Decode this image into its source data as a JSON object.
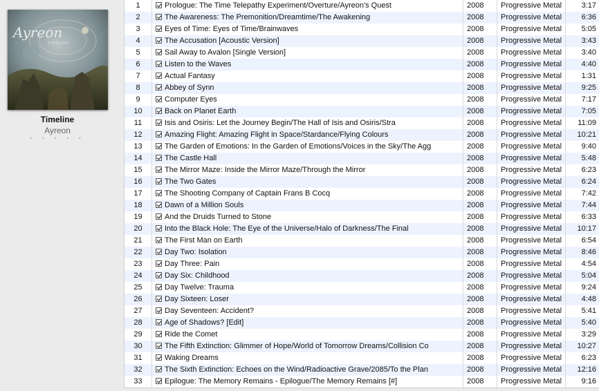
{
  "album": {
    "title": "Timeline",
    "artist": "Ayreon",
    "art_text": "Ayreon",
    "art_subtext": "TIMELINE",
    "rating": "• • • • •"
  },
  "tracks": [
    {
      "num": "1",
      "name": "Prologue: The Time Telepathy Experiment/Overture/Ayreon's Quest",
      "year": "2008",
      "genre": "Progressive Metal",
      "time": "3:17"
    },
    {
      "num": "2",
      "name": "The Awareness: The Premonition/Dreamtime/The Awakening",
      "year": "2008",
      "genre": "Progressive Metal",
      "time": "6:36"
    },
    {
      "num": "3",
      "name": "Eyes of Time: Eyes of Time/Brainwaves",
      "year": "2008",
      "genre": "Progressive Metal",
      "time": "5:05"
    },
    {
      "num": "4",
      "name": "The Accusation [Acoustic Version]",
      "year": "2008",
      "genre": "Progressive Metal",
      "time": "3:43"
    },
    {
      "num": "5",
      "name": "Sail Away to Avalon [Single Version]",
      "year": "2008",
      "genre": "Progressive Metal",
      "time": "3:40"
    },
    {
      "num": "6",
      "name": "Listen to the Waves",
      "year": "2008",
      "genre": "Progressive Metal",
      "time": "4:40"
    },
    {
      "num": "7",
      "name": "Actual Fantasy",
      "year": "2008",
      "genre": "Progressive Metal",
      "time": "1:31"
    },
    {
      "num": "8",
      "name": "Abbey of Synn",
      "year": "2008",
      "genre": "Progressive Metal",
      "time": "9:25"
    },
    {
      "num": "9",
      "name": "Computer Eyes",
      "year": "2008",
      "genre": "Progressive Metal",
      "time": "7:17"
    },
    {
      "num": "10",
      "name": "Back on Planet Earth",
      "year": "2008",
      "genre": "Progressive Metal",
      "time": "7:05"
    },
    {
      "num": "11",
      "name": "Isis and Osiris: Let the Journey Begin/The Hall of Isis and Osiris/Stra",
      "year": "2008",
      "genre": "Progressive Metal",
      "time": "11:09"
    },
    {
      "num": "12",
      "name": "Amazing Flight: Amazing Flight in Space/Stardance/Flying Colours",
      "year": "2008",
      "genre": "Progressive Metal",
      "time": "10:21"
    },
    {
      "num": "13",
      "name": "The Garden of Emotions: In the Garden of Emotions/Voices in the Sky/The Agg",
      "year": "2008",
      "genre": "Progressive Metal",
      "time": "9:40"
    },
    {
      "num": "14",
      "name": "The Castle Hall",
      "year": "2008",
      "genre": "Progressive Metal",
      "time": "5:48"
    },
    {
      "num": "15",
      "name": "The Mirror Maze: Inside the Mirror Maze/Through the Mirror",
      "year": "2008",
      "genre": "Progressive Metal",
      "time": "6:23"
    },
    {
      "num": "16",
      "name": "The Two Gates",
      "year": "2008",
      "genre": "Progressive Metal",
      "time": "6:24"
    },
    {
      "num": "17",
      "name": "The Shooting Company of Captain Frans B Cocq",
      "year": "2008",
      "genre": "Progressive Metal",
      "time": "7:42"
    },
    {
      "num": "18",
      "name": "Dawn of a Million Souls",
      "year": "2008",
      "genre": "Progressive Metal",
      "time": "7:44"
    },
    {
      "num": "19",
      "name": "And the Druids Turned to Stone",
      "year": "2008",
      "genre": "Progressive Metal",
      "time": "6:33"
    },
    {
      "num": "20",
      "name": "Into the Black Hole: The Eye of the Universe/Halo of Darkness/The Final",
      "year": "2008",
      "genre": "Progressive Metal",
      "time": "10:17"
    },
    {
      "num": "21",
      "name": "The First Man on Earth",
      "year": "2008",
      "genre": "Progressive Metal",
      "time": "6:54"
    },
    {
      "num": "22",
      "name": "Day Two: Isolation",
      "year": "2008",
      "genre": "Progressive Metal",
      "time": "8:46"
    },
    {
      "num": "23",
      "name": "Day Three: Pain",
      "year": "2008",
      "genre": "Progressive Metal",
      "time": "4:54"
    },
    {
      "num": "24",
      "name": "Day Six: Childhood",
      "year": "2008",
      "genre": "Progressive Metal",
      "time": "5:04"
    },
    {
      "num": "25",
      "name": "Day Twelve: Trauma",
      "year": "2008",
      "genre": "Progressive Metal",
      "time": "9:24"
    },
    {
      "num": "26",
      "name": "Day Sixteen: Loser",
      "year": "2008",
      "genre": "Progressive Metal",
      "time": "4:48"
    },
    {
      "num": "27",
      "name": "Day Seventeen: Accident?",
      "year": "2008",
      "genre": "Progressive Metal",
      "time": "5:41"
    },
    {
      "num": "28",
      "name": "Age of Shadows? [Edit]",
      "year": "2008",
      "genre": "Progressive Metal",
      "time": "5:40"
    },
    {
      "num": "29",
      "name": "Ride the Comet",
      "year": "2008",
      "genre": "Progressive Metal",
      "time": "3:29"
    },
    {
      "num": "30",
      "name": "The Fifth Extinction: Glimmer of Hope/World of Tomorrow Dreams/Collision Co",
      "year": "2008",
      "genre": "Progressive Metal",
      "time": "10:27"
    },
    {
      "num": "31",
      "name": "Waking Dreams",
      "year": "2008",
      "genre": "Progressive Metal",
      "time": "6:23"
    },
    {
      "num": "32",
      "name": "The Sixth Extinction: Echoes on the Wind/Radioactive Grave/2085/To the Plan",
      "year": "2008",
      "genre": "Progressive Metal",
      "time": "12:16"
    },
    {
      "num": "33",
      "name": "Epilogue: The Memory Remains - Epilogue/The Memory Remains [#]",
      "year": "2008",
      "genre": "Progressive Metal",
      "time": "9:16"
    }
  ]
}
